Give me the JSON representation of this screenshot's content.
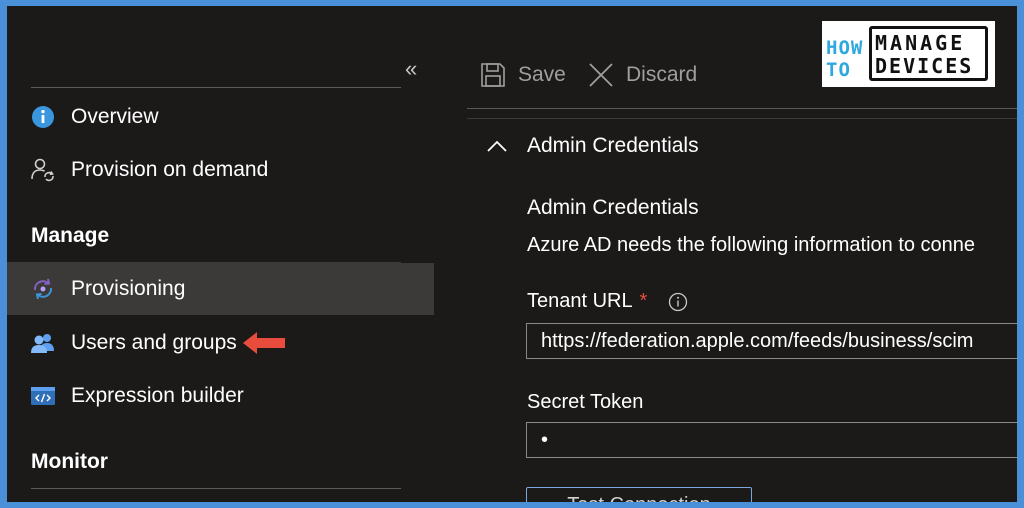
{
  "sidebar": {
    "collapse_glyph": "«",
    "items": [
      {
        "label": "Overview",
        "icon": "info-icon"
      },
      {
        "label": "Provision on demand",
        "icon": "user-sync-icon"
      }
    ],
    "manage_heading": "Manage",
    "manage_items": [
      {
        "label": "Provisioning",
        "icon": "provisioning-icon",
        "active": true
      },
      {
        "label": "Users and groups",
        "icon": "users-icon"
      },
      {
        "label": "Expression builder",
        "icon": "code-window-icon"
      }
    ],
    "monitor_heading": "Monitor"
  },
  "toolbar": {
    "save_label": "Save",
    "discard_label": "Discard"
  },
  "section": {
    "title": "Admin Credentials",
    "subtitle": "Admin Credentials",
    "description": "Azure AD needs the following information to conne",
    "tenant_url_label": "Tenant URL",
    "required_marker": "*",
    "tenant_url_value": "https://federation.apple.com/feeds/business/scim",
    "secret_token_label": "Secret Token",
    "secret_token_value": "•",
    "test_button_label": "Test Connection"
  },
  "logo": {
    "how": "HOW",
    "to": "TO",
    "manage": "MANAGE",
    "devices": "DEVICES"
  },
  "colors": {
    "background": "#1b1a19",
    "active_item": "#3b3a39",
    "accent": "#0078d4",
    "required": "#e74c3c",
    "arrow": "#e74c3c",
    "frame": "#4a90d9"
  }
}
